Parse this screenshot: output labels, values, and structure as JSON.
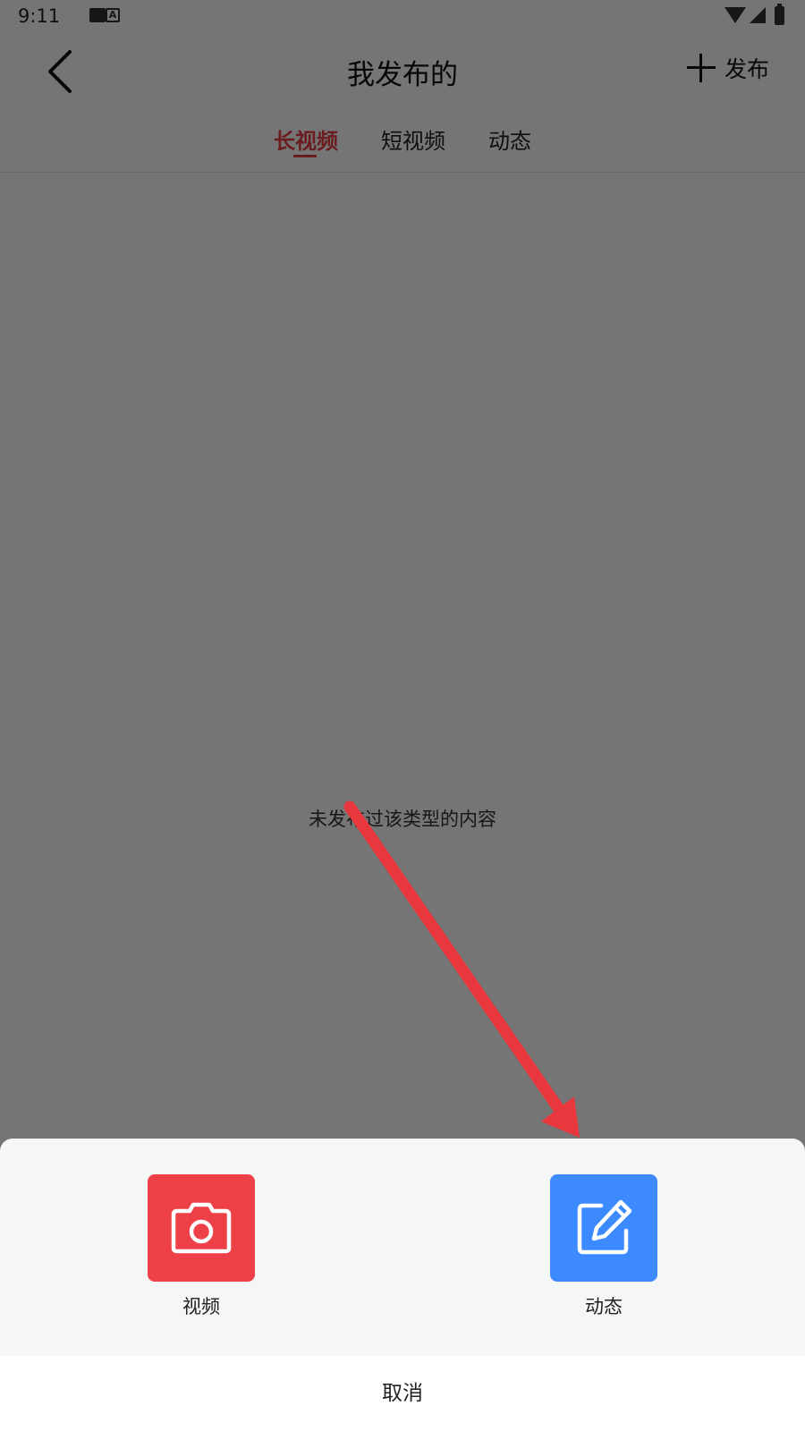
{
  "status_bar": {
    "time": "9:11"
  },
  "header": {
    "title": "我发布的",
    "publish_label": "发布"
  },
  "tabs": [
    {
      "label": "长视频",
      "active": true
    },
    {
      "label": "短视频",
      "active": false
    },
    {
      "label": "动态",
      "active": false
    }
  ],
  "empty_state": {
    "text": "未发布过该类型的内容"
  },
  "sheet": {
    "options": [
      {
        "label": "视频",
        "icon": "camera-icon",
        "color": "#ee4047"
      },
      {
        "label": "动态",
        "icon": "edit-icon",
        "color": "#3d8aff"
      }
    ],
    "cancel_label": "取消"
  },
  "colors": {
    "accent": "#e63d45",
    "arrow": "#e8383e"
  }
}
